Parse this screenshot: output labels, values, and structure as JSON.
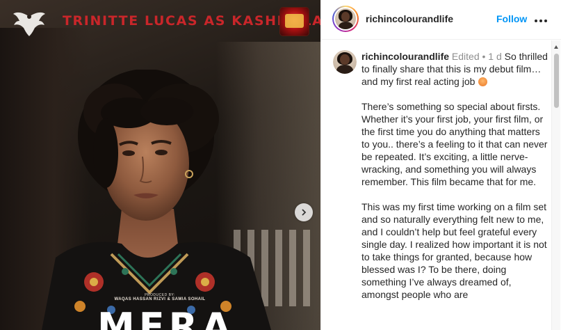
{
  "post_media": {
    "title_part1": "TRINITTE LUCAS",
    "title_part2": "AS",
    "title_part3": "KASHMALA",
    "produced_by_label": "PRODUCED BY:",
    "producers": "WAQAS HASSAN RIZVI & SAMIA SOHAIL",
    "movie_title": "MERA",
    "title_color": "#c9262a",
    "next_icon": "chevron-right-icon"
  },
  "header": {
    "username": "richincolourandlife",
    "follow_label": "Follow",
    "more_icon": "more-horizontal-icon",
    "follow_color": "#0095f6"
  },
  "caption": {
    "username": "richincolourandlife",
    "edited_label": "Edited",
    "separator": "•",
    "time_ago": "1 d",
    "paragraph1": "So thrilled to finally share that this is my debut film… and my first real acting job",
    "paragraph2": "There’s something so special about firsts. Whether it’s your first job, your first film, or the first time you do anything that matters to you.. there’s a feeling to it that can never be repeated. It’s exciting, a little nerve-wracking, and something you will always remember. This film became that for me.",
    "paragraph3": "This was my first time working on a film set and so naturally everything felt new to me, and I couldn’t help but feel grateful every single day. I realized how important it is not to take things for granted, because how blessed was I? To be there, doing something I’ve always dreamed of, amongst people who are"
  }
}
